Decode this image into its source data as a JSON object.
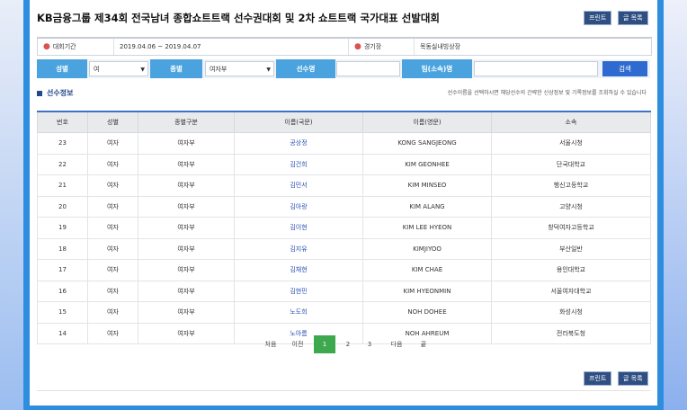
{
  "title": "KB금융그룹 제34회 전국남녀 종합쇼트트랙 선수권대회 및 2차 쇼트트랙 국가대표 선발대회",
  "buttons": {
    "print": "프린트",
    "list": "글 목록"
  },
  "info": {
    "period_label": "대회기간",
    "period_value": "2019.04.06 ~ 2019.04.07",
    "venue_label": "경기장",
    "venue_value": "목동실내빙상장"
  },
  "search": {
    "gender_label": "성별",
    "gender_value": "여",
    "event_label": "종별",
    "event_value": "여자부",
    "name_label": "선수명",
    "team_label": "팀(소속)명",
    "search_button": "검색"
  },
  "section": {
    "title": "선수정보",
    "notice": "선수이름을 선택하시면 해당선수의 간략한 신상정보 및 기록정보를 조회하실 수 있습니다"
  },
  "table": {
    "headers": [
      "번호",
      "성별",
      "종별구분",
      "이름(국문)",
      "이름(영문)",
      "소속"
    ],
    "rows": [
      [
        "23",
        "여자",
        "여자부",
        "공상정",
        "KONG SANGJEONG",
        "서울시청"
      ],
      [
        "22",
        "여자",
        "여자부",
        "김건희",
        "KIM GEONHEE",
        "단국대학교"
      ],
      [
        "21",
        "여자",
        "여자부",
        "김민서",
        "KIM MINSEO",
        "행신고등학교"
      ],
      [
        "20",
        "여자",
        "여자부",
        "김아랑",
        "KIM ALANG",
        "고양시청"
      ],
      [
        "19",
        "여자",
        "여자부",
        "김이현",
        "KIM LEE HYEON",
        "창덕여자고등학교"
      ],
      [
        "18",
        "여자",
        "여자부",
        "김지유",
        "KIMJIYOO",
        "부산일반"
      ],
      [
        "17",
        "여자",
        "여자부",
        "김채현",
        "KIM CHAE",
        "용인대학교"
      ],
      [
        "16",
        "여자",
        "여자부",
        "김현민",
        "KIM HYEONMIN",
        "서울여자대학교"
      ],
      [
        "15",
        "여자",
        "여자부",
        "노도희",
        "NOH DOHEE",
        "화성시청"
      ],
      [
        "14",
        "여자",
        "여자부",
        "노아름",
        "NOH AHREUM",
        "전라북도청"
      ]
    ]
  },
  "pagination": {
    "first": "처음",
    "prev": "이전",
    "pages": [
      "1",
      "2",
      "3"
    ],
    "current": "1",
    "next": "다음",
    "last": "끝"
  },
  "colors": {
    "frame": "#2f8de0",
    "label_bg": "#4aa3df",
    "search_button": "#2f6ad0",
    "nav_button": "#2f4f83",
    "active_page": "#3ea84f",
    "name_link": "#2a4fb5"
  }
}
